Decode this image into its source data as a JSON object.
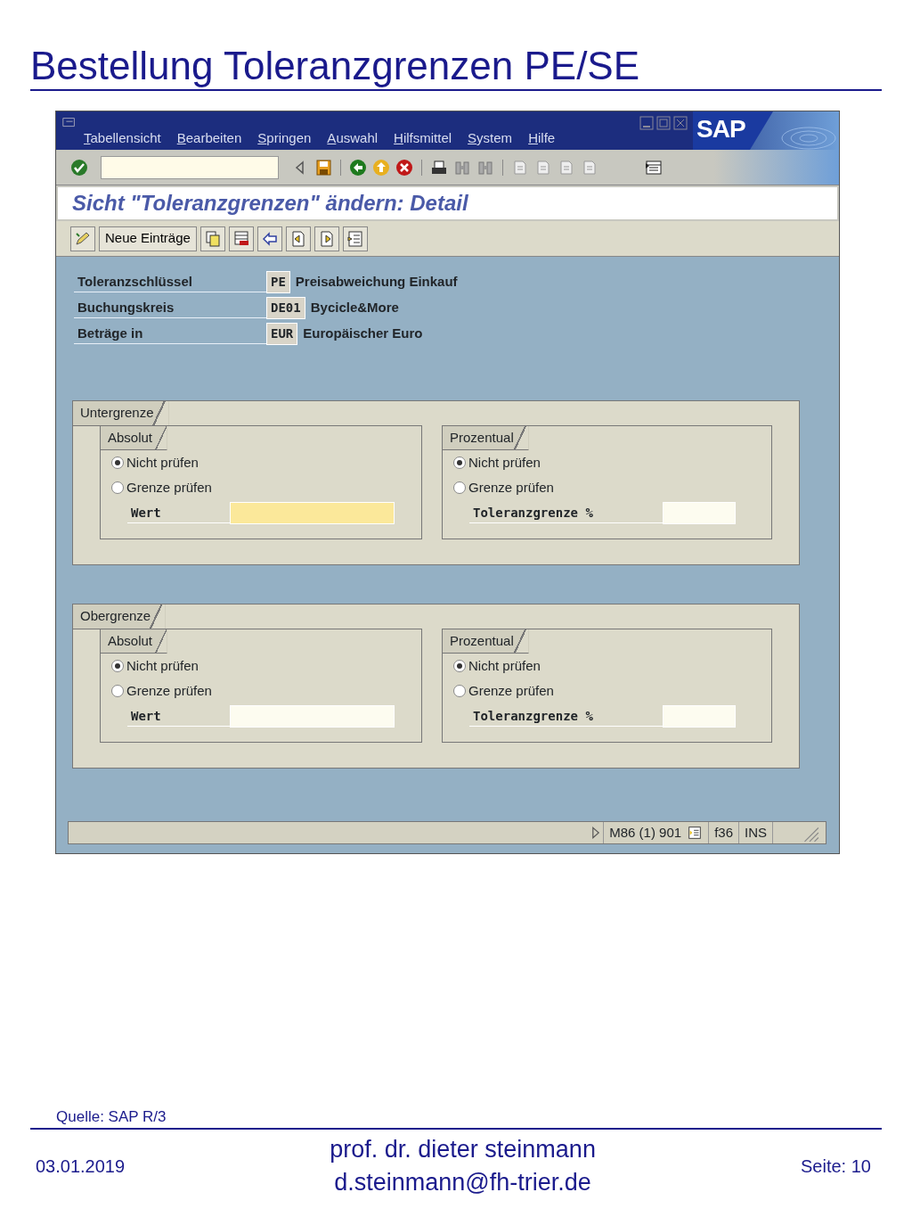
{
  "slide_title": "Bestellung Toleranzgrenzen PE/SE",
  "window": {
    "menu": [
      "Tabellensicht",
      "Bearbeiten",
      "Springen",
      "Auswahl",
      "Hilfsmittel",
      "System",
      "Hilfe"
    ],
    "logo": "SAP",
    "screen_title": "Sicht \"Toleranzgrenzen\" ändern: Detail",
    "app_toolbar": {
      "button": "Neue Einträge"
    },
    "header_fields": [
      {
        "label": "Toleranzschlüssel",
        "value": "PE",
        "description": "Preisabweichung Einkauf"
      },
      {
        "label": "Buchungskreis",
        "value": "DE01",
        "description": "Bycicle&More"
      },
      {
        "label": "Beträge in",
        "value": "EUR",
        "description": "Europäischer Euro"
      }
    ],
    "groups": [
      {
        "title": "Untergrenze",
        "subgroups": [
          {
            "title": "Absolut",
            "radios": [
              {
                "label": "Nicht prüfen",
                "selected": true
              },
              {
                "label": "Grenze prüfen",
                "selected": false
              }
            ],
            "field": {
              "label": "Wert",
              "focused": true
            }
          },
          {
            "title": "Prozentual",
            "radios": [
              {
                "label": "Nicht prüfen",
                "selected": true
              },
              {
                "label": "Grenze prüfen",
                "selected": false
              }
            ],
            "field": {
              "label": "Toleranzgrenze %",
              "focused": false
            }
          }
        ]
      },
      {
        "title": "Obergrenze",
        "subgroups": [
          {
            "title": "Absolut",
            "radios": [
              {
                "label": "Nicht prüfen",
                "selected": true
              },
              {
                "label": "Grenze prüfen",
                "selected": false
              }
            ],
            "field": {
              "label": "Wert",
              "focused": false
            }
          },
          {
            "title": "Prozentual",
            "radios": [
              {
                "label": "Nicht prüfen",
                "selected": true
              },
              {
                "label": "Grenze prüfen",
                "selected": false
              }
            ],
            "field": {
              "label": "Toleranzgrenze %",
              "focused": false
            }
          }
        ]
      }
    ],
    "status_bar": {
      "system": "M86 (1) 901",
      "server": "f36",
      "mode": "INS"
    }
  },
  "source": "Quelle: SAP R/3",
  "footer": {
    "date": "03.01.2019",
    "author": "prof. dr. dieter steinmann",
    "email": "d.steinmann@fh-trier.de",
    "page": "Seite: 10"
  }
}
